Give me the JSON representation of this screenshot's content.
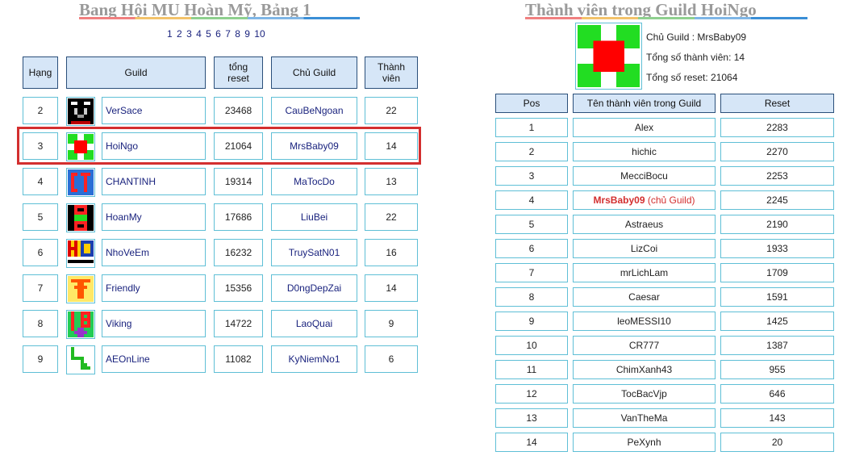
{
  "left": {
    "title": "Bang Hội MU Hoàn Mỹ, Bảng 1",
    "pages": [
      "1",
      "2",
      "3",
      "4",
      "5",
      "6",
      "7",
      "8",
      "9",
      "10"
    ],
    "headers": {
      "rank": "Hạng",
      "guild": "Guild",
      "reset_1": "tổng",
      "reset_2": "reset",
      "master": "Chủ Guild",
      "members_1": "Thành",
      "members_2": "viên"
    },
    "rows": [
      {
        "rank": "2",
        "guild": "VerSace",
        "reset": "23468",
        "master": "CauBeNgoan",
        "members": "22",
        "logo": "versace-logo"
      },
      {
        "rank": "3",
        "guild": "HoiNgo",
        "reset": "21064",
        "master": "MrsBaby09",
        "members": "14",
        "logo": "hoingo-logo"
      },
      {
        "rank": "4",
        "guild": "CHANTINH",
        "reset": "19314",
        "master": "MaTocDo",
        "members": "13",
        "logo": "chantinh-logo"
      },
      {
        "rank": "5",
        "guild": "HoanMy",
        "reset": "17686",
        "master": "LiuBei",
        "members": "22",
        "logo": "hoanmy-logo"
      },
      {
        "rank": "6",
        "guild": "NhoVeEm",
        "reset": "16232",
        "master": "TruySatN01",
        "members": "16",
        "logo": "nhoveem-logo"
      },
      {
        "rank": "7",
        "guild": "Friendly",
        "reset": "15356",
        "master": "D0ngDepZai",
        "members": "14",
        "logo": "friendly-logo"
      },
      {
        "rank": "8",
        "guild": "Viking",
        "reset": "14722",
        "master": "LaoQuai",
        "members": "9",
        "logo": "viking-logo"
      },
      {
        "rank": "9",
        "guild": "AEOnLine",
        "reset": "11082",
        "master": "KyNiemNo1",
        "members": "6",
        "logo": "aeonline-logo"
      }
    ]
  },
  "right": {
    "title": "Thành viên trong Guild HoiNgo",
    "info": {
      "master": "Chủ Guild : MrsBaby09",
      "member_count": "Tổng số thành viên: 14",
      "total_reset": "Tổng số reset: 21064"
    },
    "headers": {
      "pos": "Pos",
      "name": "Tên thành viên trong Guild",
      "reset": "Reset"
    },
    "leader_suffix": " (chủ Guild)",
    "rows": [
      {
        "pos": "1",
        "name": "Alex",
        "reset": "2283"
      },
      {
        "pos": "2",
        "name": "hichic",
        "reset": "2270"
      },
      {
        "pos": "3",
        "name": "MecciBocu",
        "reset": "2253"
      },
      {
        "pos": "4",
        "name": "MrsBaby09",
        "reset": "2245"
      },
      {
        "pos": "5",
        "name": "Astraeus",
        "reset": "2190"
      },
      {
        "pos": "6",
        "name": "LizCoi",
        "reset": "1933"
      },
      {
        "pos": "7",
        "name": "mrLichLam",
        "reset": "1709"
      },
      {
        "pos": "8",
        "name": "Caesar",
        "reset": "1591"
      },
      {
        "pos": "9",
        "name": "leoMESSI10",
        "reset": "1425"
      },
      {
        "pos": "10",
        "name": "CR777",
        "reset": "1387"
      },
      {
        "pos": "11",
        "name": "ChimXanh43",
        "reset": "955"
      },
      {
        "pos": "12",
        "name": "TocBacVjp",
        "reset": "646"
      },
      {
        "pos": "13",
        "name": "VanTheMa",
        "reset": "143"
      },
      {
        "pos": "14",
        "name": "PeXynh",
        "reset": "20"
      }
    ]
  }
}
